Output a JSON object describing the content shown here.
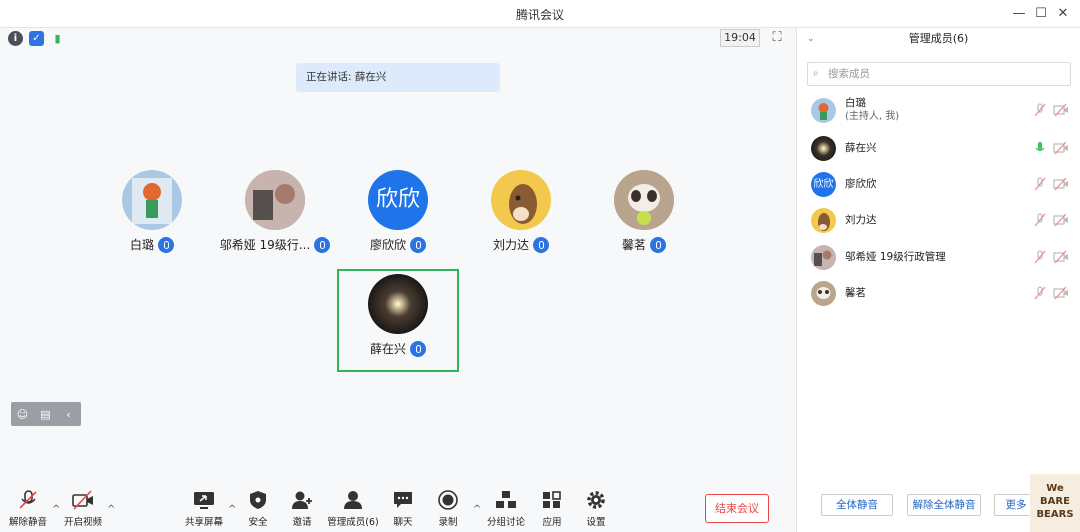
{
  "window": {
    "title": "腾讯会议"
  },
  "status": {
    "time": "19:04"
  },
  "speaking": "正在讲话: 薛在兴",
  "participants": [
    {
      "name": "白璐",
      "avatar": "parrot-avatar"
    },
    {
      "name": "邬希娅 19级行...",
      "avatar": "photo-avatar"
    },
    {
      "name": "廖欣欣",
      "avatar_text": "欣欣"
    },
    {
      "name": "刘力达",
      "avatar": "horse-avatar"
    },
    {
      "name": "馨茗",
      "avatar": "dog-avatar"
    },
    {
      "name": "薛在兴",
      "avatar": "light-avatar"
    }
  ],
  "toolbar": {
    "unmute": "解除静音",
    "start_video": "开启视频",
    "share": "共享屏幕",
    "security": "安全",
    "invite": "邀请",
    "manage": "管理成员(6)",
    "chat": "聊天",
    "record": "录制",
    "breakout": "分组讨论",
    "apps": "应用",
    "settings": "设置",
    "end": "结束会议"
  },
  "panel": {
    "title": "管理成员(6)",
    "search_placeholder": "搜索成员",
    "members": [
      {
        "name": "白璐",
        "sub": "(主持人, 我)"
      },
      {
        "name": "薛在兴"
      },
      {
        "name": "廖欣欣",
        "avatar_text": "欣欣"
      },
      {
        "name": "刘力达"
      },
      {
        "name": "邬希娅 19级行政管理"
      },
      {
        "name": "馨茗"
      }
    ],
    "mute_all": "全体静音",
    "unmute_all": "解除全体静音",
    "more": "更多"
  },
  "brand": {
    "line1": "We",
    "line2": "BARE",
    "line3": "BEARS"
  },
  "colors": {
    "accent": "#2b74e2",
    "active": "#2fb55c",
    "danger": "#e84848"
  }
}
